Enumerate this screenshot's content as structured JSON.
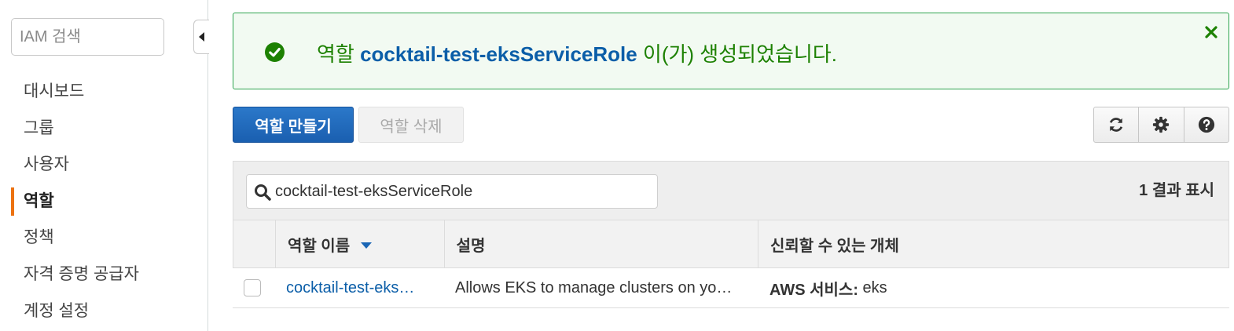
{
  "sidebar": {
    "search_placeholder": "IAM 검색",
    "items": [
      {
        "label": "대시보드"
      },
      {
        "label": "그룹"
      },
      {
        "label": "사용자"
      },
      {
        "label": "역할",
        "active": true
      },
      {
        "label": "정책"
      },
      {
        "label": "자격 증명 공급자"
      },
      {
        "label": "계정 설정"
      }
    ]
  },
  "flash": {
    "prefix": "역할 ",
    "role_name": "cocktail-test-eksServiceRole",
    "suffix": " 이(가) 생성되었습니다.",
    "status_color": "#1d8102",
    "icons": {
      "status": "check-circle-icon",
      "close": "close-icon"
    }
  },
  "toolbar": {
    "create_label": "역할 만들기",
    "delete_label": "역할 삭제",
    "icons": [
      "refresh-icon",
      "gear-icon",
      "help-icon"
    ]
  },
  "table": {
    "filter_value": "cocktail-test-eksServiceRole",
    "results_label": "1 결과 표시",
    "columns": [
      "역할 이름",
      "설명",
      "신뢰할 수 있는 개체"
    ],
    "rows": [
      {
        "name": "cocktail-test-eks…",
        "description": "Allows EKS to manage clusters on yo…",
        "trusted_prefix": "AWS 서비스:",
        "trusted_value": " eks"
      }
    ]
  },
  "colors": {
    "accent": "#ec7211",
    "primary_button": "#1a66b5",
    "link": "#0b5ea8",
    "success_border": "#2ea44f"
  }
}
